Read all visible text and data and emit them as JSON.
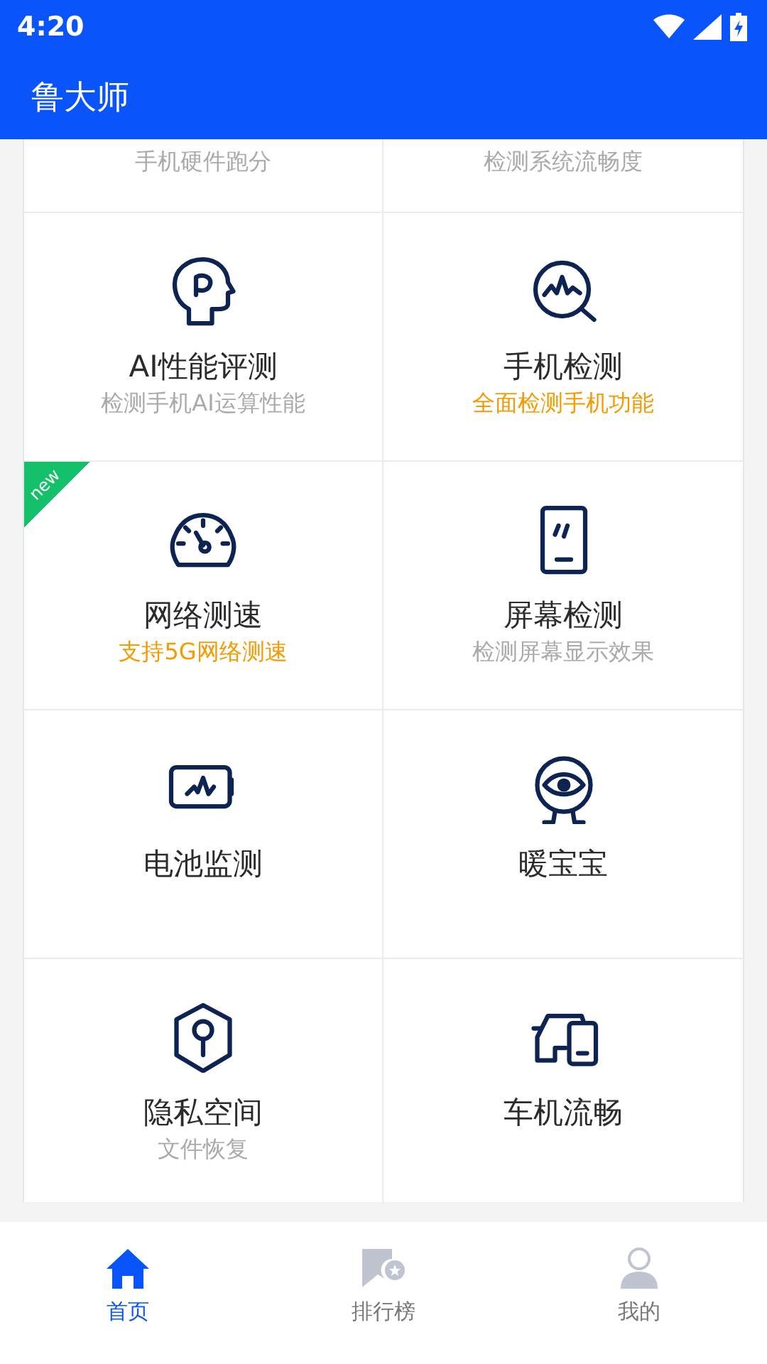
{
  "status_bar": {
    "time": "4:20"
  },
  "app_bar": {
    "title": "鲁大师"
  },
  "partial_row": [
    {
      "subtitle": "手机硬件跑分",
      "highlight": false
    },
    {
      "subtitle": "检测系统流畅度",
      "highlight": false
    }
  ],
  "features": [
    {
      "title": "AI性能评测",
      "subtitle": "检测手机AI运算性能",
      "highlight": false
    },
    {
      "title": "手机检测",
      "subtitle": "全面检测手机功能",
      "highlight": true
    },
    {
      "title": "网络测速",
      "subtitle": "支持5G网络测速",
      "highlight": true,
      "new": true,
      "badge": "new"
    },
    {
      "title": "屏幕检测",
      "subtitle": "检测屏幕显示效果",
      "highlight": false
    },
    {
      "title": "电池监测"
    },
    {
      "title": "暖宝宝"
    },
    {
      "title": "隐私空间",
      "subtitle": "文件恢复",
      "highlight": false
    },
    {
      "title": "车机流畅"
    }
  ],
  "bottom_nav": [
    {
      "label": "首页",
      "selected": true
    },
    {
      "label": "排行榜",
      "selected": false
    },
    {
      "label": "我的",
      "selected": false
    }
  ]
}
